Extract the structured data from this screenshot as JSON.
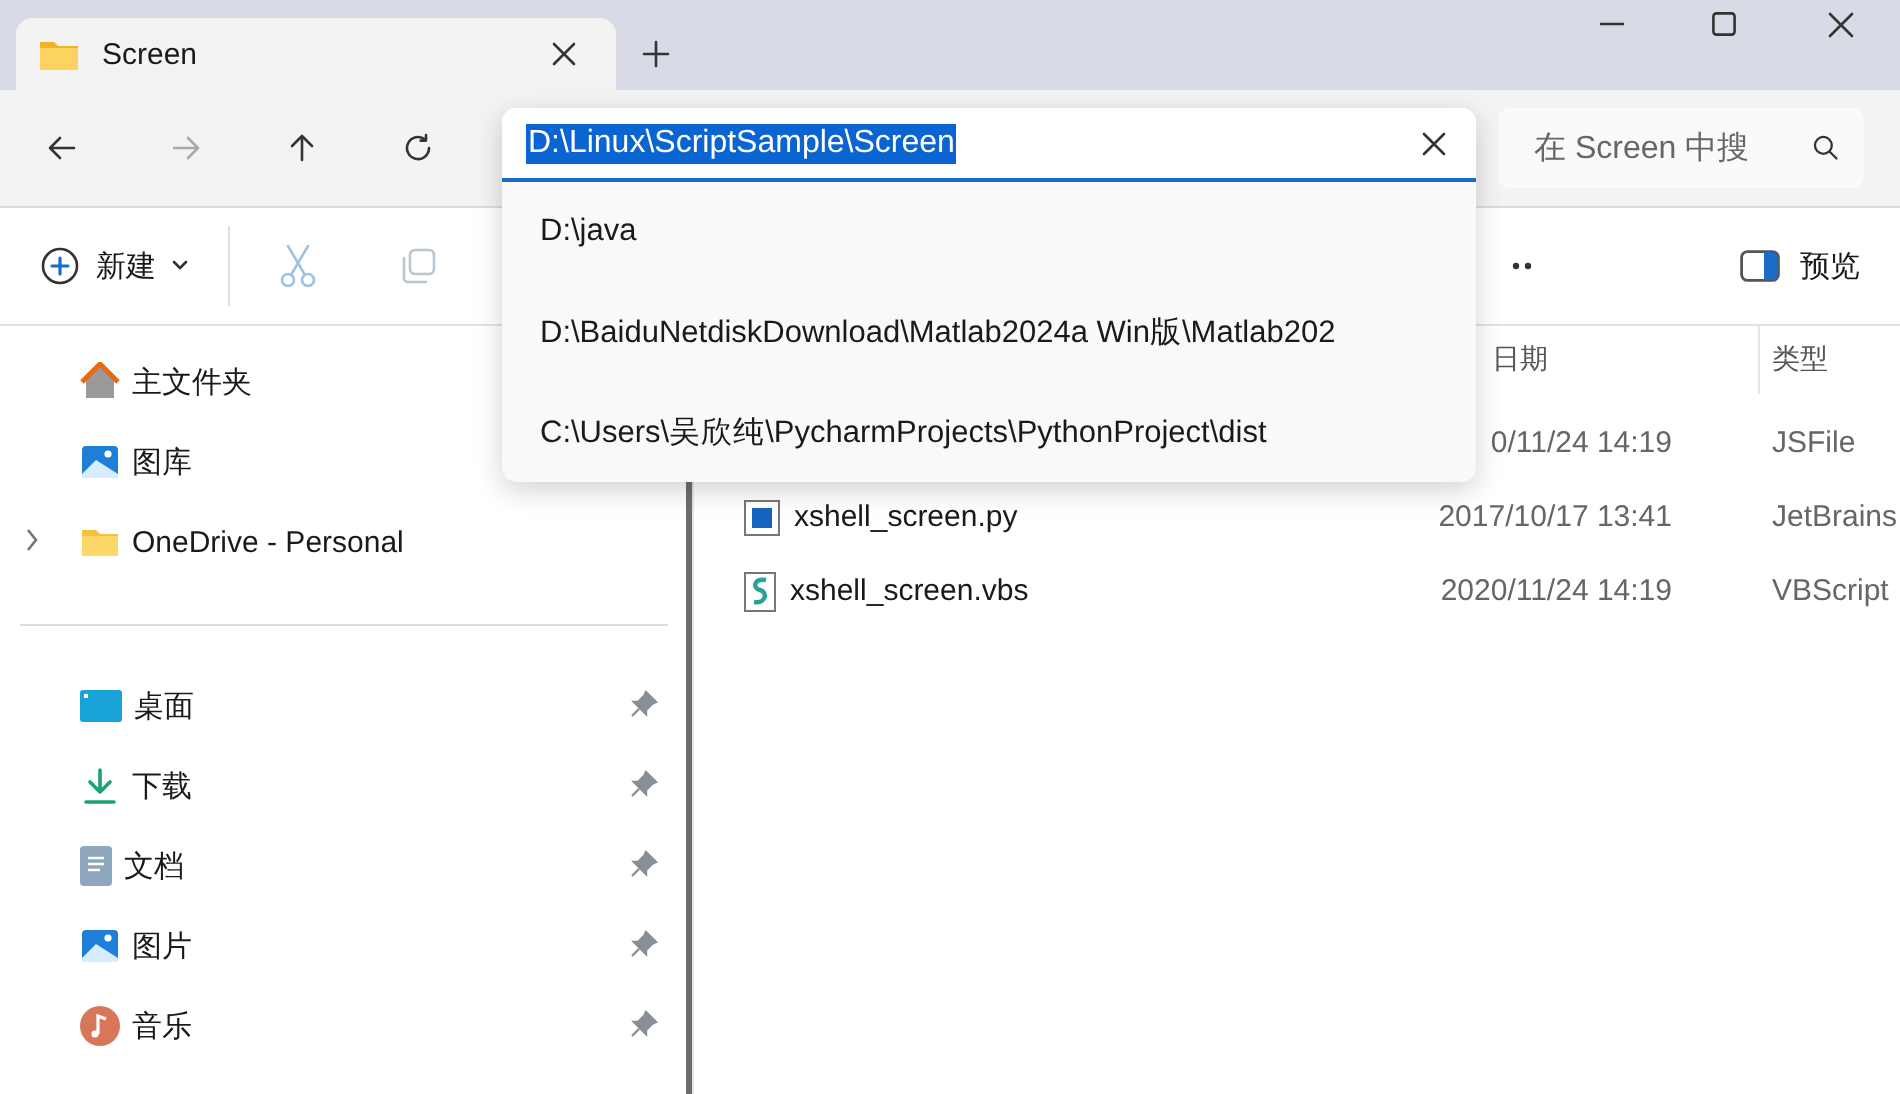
{
  "tab": {
    "title": "Screen"
  },
  "address_bar": {
    "value": "D:\\Linux\\ScriptSample\\Screen",
    "highlighted": true
  },
  "address_suggestions": [
    "D:\\java",
    "D:\\BaiduNetdiskDownload\\Matlab2024a Win版\\Matlab202",
    "C:\\Users\\吴欣纯\\PycharmProjects\\PythonProject\\dist"
  ],
  "search": {
    "placeholder": "在 Screen 中搜"
  },
  "toolbar": {
    "new_label": "新建",
    "preview_label": "预览"
  },
  "sidebar": {
    "items": [
      {
        "label": "主文件夹",
        "kind": "home",
        "expandable": false
      },
      {
        "label": "图库",
        "kind": "gallery",
        "expandable": false
      },
      {
        "label": "OneDrive - Personal",
        "kind": "folder",
        "expandable": true
      }
    ],
    "quick_access": [
      {
        "label": "桌面",
        "kind": "desktop",
        "pinned": true
      },
      {
        "label": "下载",
        "kind": "download",
        "pinned": true
      },
      {
        "label": "文档",
        "kind": "document",
        "pinned": true
      },
      {
        "label": "图片",
        "kind": "picture",
        "pinned": true
      },
      {
        "label": "音乐",
        "kind": "music",
        "pinned": true
      }
    ]
  },
  "file_list": {
    "columns": [
      "日期",
      "类型"
    ],
    "rows": [
      {
        "date": "0/11/24 14:19",
        "type": "JSFile"
      },
      {
        "name": "xshell_screen.py",
        "kind": "py",
        "date": "2017/10/17 13:41",
        "type": "JetBrains"
      },
      {
        "name": "xshell_screen.vbs",
        "kind": "vbs",
        "date": "2020/11/24 14:19",
        "type": "VBScript"
      }
    ]
  }
}
